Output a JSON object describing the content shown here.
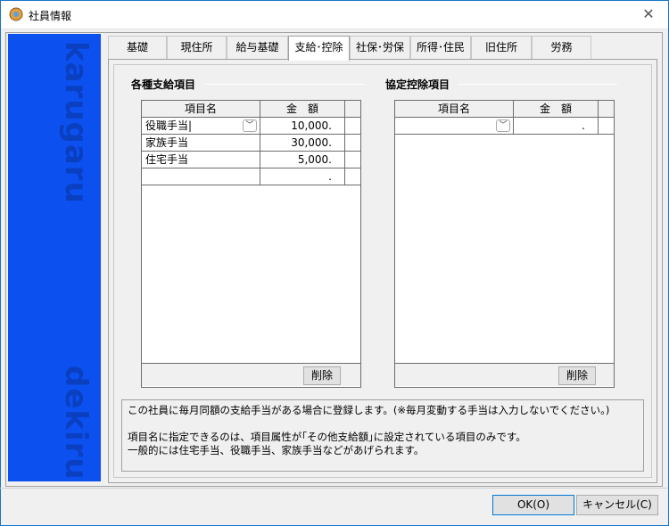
{
  "window": {
    "title": "社員情報",
    "close_glyph": "✕"
  },
  "brand": {
    "word_top": "karugaru",
    "word_bottom": "dekiru",
    "color": "#0c51f0"
  },
  "tabs": [
    {
      "label": "基礎"
    },
    {
      "label": "現住所"
    },
    {
      "label": "給与基礎"
    },
    {
      "label": "支給･控除",
      "active": true
    },
    {
      "label": "社保･労保"
    },
    {
      "label": "所得･住民"
    },
    {
      "label": "旧住所"
    },
    {
      "label": "労務"
    }
  ],
  "allowance": {
    "group_label": "各種支給項目",
    "col_name": "項目名",
    "col_amount": "金　額",
    "rows": [
      {
        "name": "役職手当|",
        "amount": "10,000."
      },
      {
        "name": "家族手当",
        "amount": "30,000."
      },
      {
        "name": "住宅手当",
        "amount": "5,000."
      },
      {
        "name": "",
        "amount": "."
      }
    ],
    "delete_label": "削除"
  },
  "deduction": {
    "group_label": "協定控除項目",
    "col_name": "項目名",
    "col_amount": "金　額",
    "rows": [
      {
        "name": "",
        "amount": "."
      }
    ],
    "delete_label": "削除"
  },
  "note": {
    "line1": "この社員に毎月同額の支給手当がある場合に登録します。(※毎月変動する手当は入力しないでください。)",
    "line2": "項目名に指定できるのは、項目属性が｢その他支給額｣に設定されている項目のみです。",
    "line3": "一般的には住宅手当、役職手当、家族手当などがあげられます。"
  },
  "footer": {
    "ok_label": "OK(O)",
    "cancel_label": "キャンセル(C)"
  }
}
